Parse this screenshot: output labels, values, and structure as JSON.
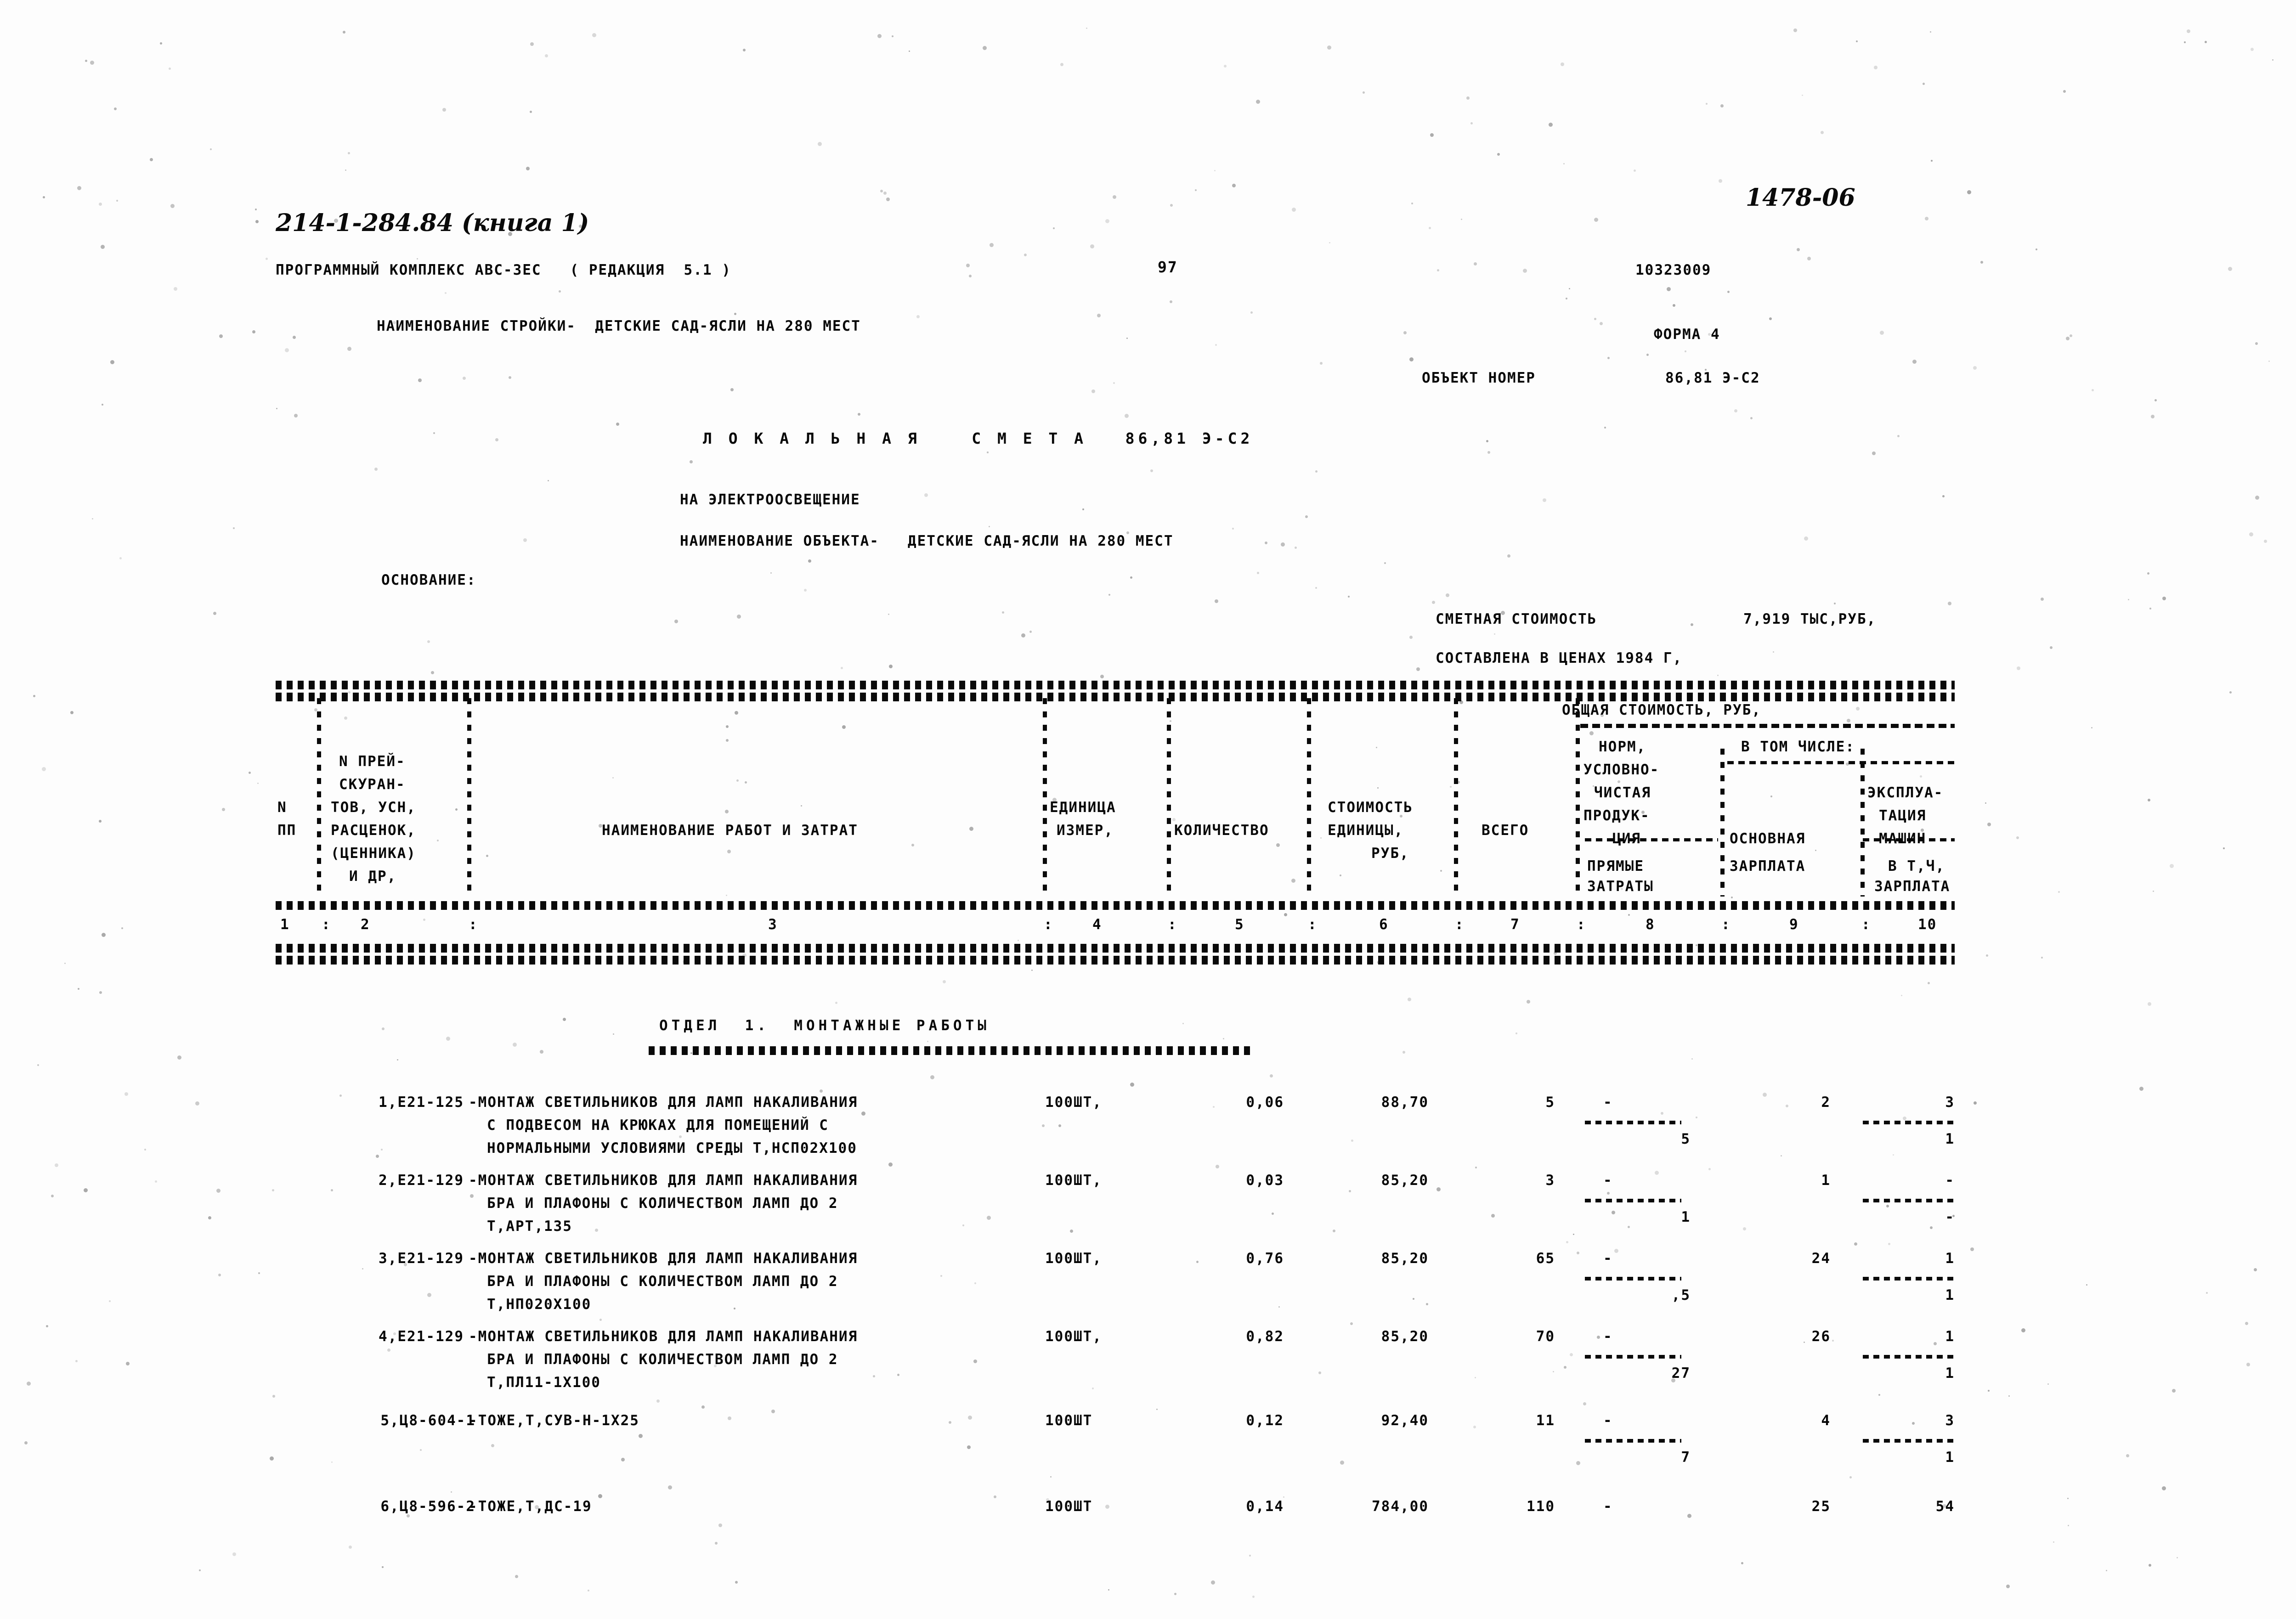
{
  "page": {
    "project_code": "214-1-284.84 (книга 1)",
    "archive_mark": "1478-06",
    "software_line": "ПРОГРАММНЫЙ КОМПЛЕКС АВС-ЗЕС   ( РЕДАКЦИЯ  5.1 )",
    "page_number": "97",
    "doc_number": "10323009",
    "construction_label": "НАИМЕНОВАНИЕ СТРОЙКИ-  ДЕТСКИЕ САД-ЯСЛИ НА 280 МЕСТ",
    "form_label": "ФОРМА 4",
    "object_number_label": "ОБЪЕКТ НОМЕР",
    "object_number_value": "86,81 Э-С2",
    "title": "Л О К А Л Ь Н А Я    С М Е Т А   86,81 Э-С2",
    "subtitle": "НА ЭЛЕКТРООСВЕЩЕНИЕ",
    "object_name_line": "НАИМЕНОВАНИЕ ОБЪЕКТА-   ДЕТСКИЕ САД-ЯСЛИ НА 280 МЕСТ",
    "basis_label": "ОСНОВАНИЕ:",
    "total_cost_label": "СМЕТНАЯ СТОИМОСТЬ",
    "total_cost_value": "7,919 ТЫС,РУБ,",
    "prices_line": "СОСТАВЛЕНА В ЦЕНАХ 1984 Г,"
  },
  "table": {
    "header": {
      "col1_a": "N",
      "col1_b": "ПП",
      "col2_lines": [
        "N ПРЕЙ-",
        "СКУРАН-",
        "ТОВ, УСН,",
        "РАСЦЕНОК,",
        "(ЦЕННИКА)",
        "И ДР,"
      ],
      "col3": "НАИМЕНОВАНИЕ РАБОТ И ЗАТРАТ",
      "col4_lines": [
        "ЕДИНИЦА",
        "ИЗМЕР,"
      ],
      "col5": "КОЛИЧЕСТВО",
      "col6_lines": [
        "СТОИМОСТЬ",
        "ЕДИНИЦЫ,",
        "РУБ,"
      ],
      "col7": "ВСЕГО",
      "group_title": "ОБЩАЯ СТОИМОСТЬ, РУБ,",
      "col8_lines": [
        "НОРМ,",
        "УСЛОВНО-",
        "ЧИСТАЯ",
        "ПРОДУК-",
        "ЦИЯ",
        "ПРЯМЫЕ",
        "ЗАТРАТЫ"
      ],
      "in_total": "В ТОМ ЧИСЛЕ:",
      "col9_lines": [
        "ОСНОВНАЯ",
        "ЗАРПЛАТА"
      ],
      "col10_lines": [
        "ЭКСПЛУА-",
        "ТАЦИЯ",
        "МАШИН",
        "В Т,Ч,",
        "ЗАРПЛАТА"
      ],
      "numbers": [
        "1",
        "2",
        "3",
        "4",
        "5",
        "6",
        "7",
        "8",
        "9",
        "10"
      ]
    },
    "section_title": "ОТДЕЛ  1.  МОНТАЖНЫЕ РАБОТЫ",
    "rows": [
      {
        "num_code": "1,Е21-125",
        "desc": [
          "-МОНТАЖ СВЕТИЛЬНИКОВ ДЛЯ ЛАМП НАКАЛИВАНИЯ",
          "С ПОДВЕСОМ НА КРЮКАХ ДЛЯ ПОМЕЩЕНИЙ С",
          "НОРМАЛЬНЫМИ УСЛОВИЯМИ СРЕДЫ Т,НСП02Х100"
        ],
        "unit": "100ШТ,",
        "qty": "0,06",
        "unit_cost": "88,70",
        "total": "5",
        "net_product": "-",
        "net_product_under": "5",
        "basic_wage": "2",
        "machines": "3",
        "machines_under": "1"
      },
      {
        "num_code": "2,Е21-129",
        "desc": [
          "-МОНТАЖ СВЕТИЛЬНИКОВ ДЛЯ ЛАМП НАКАЛИВАНИЯ",
          "БРА И ПЛАФОНЫ С КОЛИЧЕСТВОМ ЛАМП ДО 2",
          "Т,АРТ,135"
        ],
        "unit": "100ШТ,",
        "qty": "0,03",
        "unit_cost": "85,20",
        "total": "3",
        "net_product": "-",
        "net_product_under": "1",
        "basic_wage": "1",
        "machines": "-",
        "machines_under": "-"
      },
      {
        "num_code": "3,Е21-129",
        "desc": [
          "-МОНТАЖ СВЕТИЛЬНИКОВ ДЛЯ ЛАМП НАКАЛИВАНИЯ",
          "БРА И ПЛАФОНЫ С КОЛИЧЕСТВОМ ЛАМП ДО 2",
          "Т,НП020Х100"
        ],
        "unit": "100ШТ,",
        "qty": "0,76",
        "unit_cost": "85,20",
        "total": "65",
        "net_product": "-",
        "net_product_under": ",5",
        "basic_wage": "24",
        "machines": "1",
        "machines_under": "1"
      },
      {
        "num_code": "4,Е21-129",
        "desc": [
          "-МОНТАЖ СВЕТИЛЬНИКОВ ДЛЯ ЛАМП НАКАЛИВАНИЯ",
          "БРА И ПЛАФОНЫ С КОЛИЧЕСТВОМ ЛАМП ДО 2",
          "Т,ПЛ11-1Х100"
        ],
        "unit": "100ШТ,",
        "qty": "0,82",
        "unit_cost": "85,20",
        "total": "70",
        "net_product": "-",
        "net_product_under": "27",
        "basic_wage": "26",
        "machines": "1",
        "machines_under": "1"
      },
      {
        "num_code": "5,Ц8-604-1",
        "desc": [
          "-ТОЖЕ,Т,СУВ-Н-1Х25"
        ],
        "unit": "100ШТ",
        "qty": "0,12",
        "unit_cost": "92,40",
        "total": "11",
        "net_product": "-",
        "net_product_under": "7",
        "basic_wage": "4",
        "machines": "3",
        "machines_under": "1"
      },
      {
        "num_code": "6,Ц8-596-2",
        "desc": [
          "-ТОЖЕ,Т,ДС-19"
        ],
        "unit": "100ШТ",
        "qty": "0,14",
        "unit_cost": "784,00",
        "total": "110",
        "net_product": "-",
        "net_product_under": "",
        "basic_wage": "25",
        "machines": "54",
        "machines_under": ""
      }
    ]
  }
}
